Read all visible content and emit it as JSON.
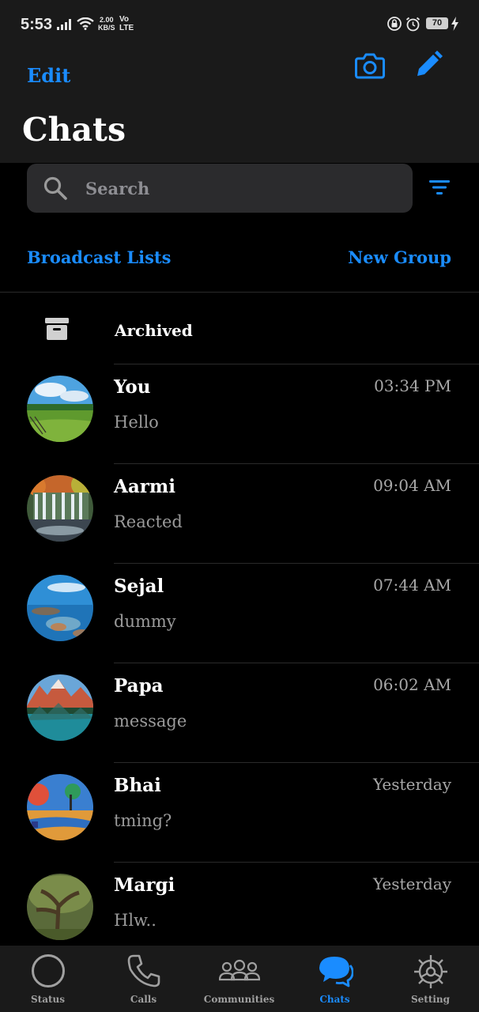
{
  "status_bar": {
    "time": "5:53",
    "speed_value": "2.00",
    "speed_unit": "KB/S",
    "volte_top": "Vo",
    "volte_bottom": "LTE",
    "battery": "70"
  },
  "header": {
    "edit_label": "Edit",
    "title": "Chats",
    "camera_icon": "camera-icon",
    "compose_icon": "pencil-icon"
  },
  "search": {
    "placeholder": "Search"
  },
  "actions": {
    "broadcast": "Broadcast Lists",
    "new_group": "New Group"
  },
  "archived": {
    "label": "Archived",
    "icon": "archive-box-icon"
  },
  "chats": [
    {
      "name": "You",
      "time": "03:34 PM",
      "message": "Hello",
      "avatar": "landscape-meadow"
    },
    {
      "name": "Aarmi",
      "time": "09:04 AM",
      "message": "Reacted",
      "avatar": "waterfall"
    },
    {
      "name": "Sejal",
      "time": "07:44 AM",
      "message": "dummy",
      "avatar": "beach-rocks"
    },
    {
      "name": "Papa",
      "time": "06:02 AM",
      "message": "message",
      "avatar": "mountain-lake"
    },
    {
      "name": "Bhai",
      "time": "Yesterday",
      "message": "tming?",
      "avatar": "autumn-park"
    },
    {
      "name": "Margi",
      "time": "Yesterday",
      "message": "Hlw..",
      "avatar": "forest-tree"
    }
  ],
  "tabs": [
    {
      "label": "Status",
      "icon": "status-ring-icon",
      "active": false
    },
    {
      "label": "Calls",
      "icon": "phone-icon",
      "active": false
    },
    {
      "label": "Communities",
      "icon": "people-group-icon",
      "active": false
    },
    {
      "label": "Chats",
      "icon": "chat-bubbles-icon",
      "active": true
    },
    {
      "label": "Setting",
      "icon": "gear-icon",
      "active": false
    }
  ],
  "colors": {
    "accent": "#1a8cff",
    "background": "#000000",
    "bar": "#1a1a1a",
    "search_bg": "#2b2b2d",
    "secondary_text": "#9a9a9a"
  }
}
